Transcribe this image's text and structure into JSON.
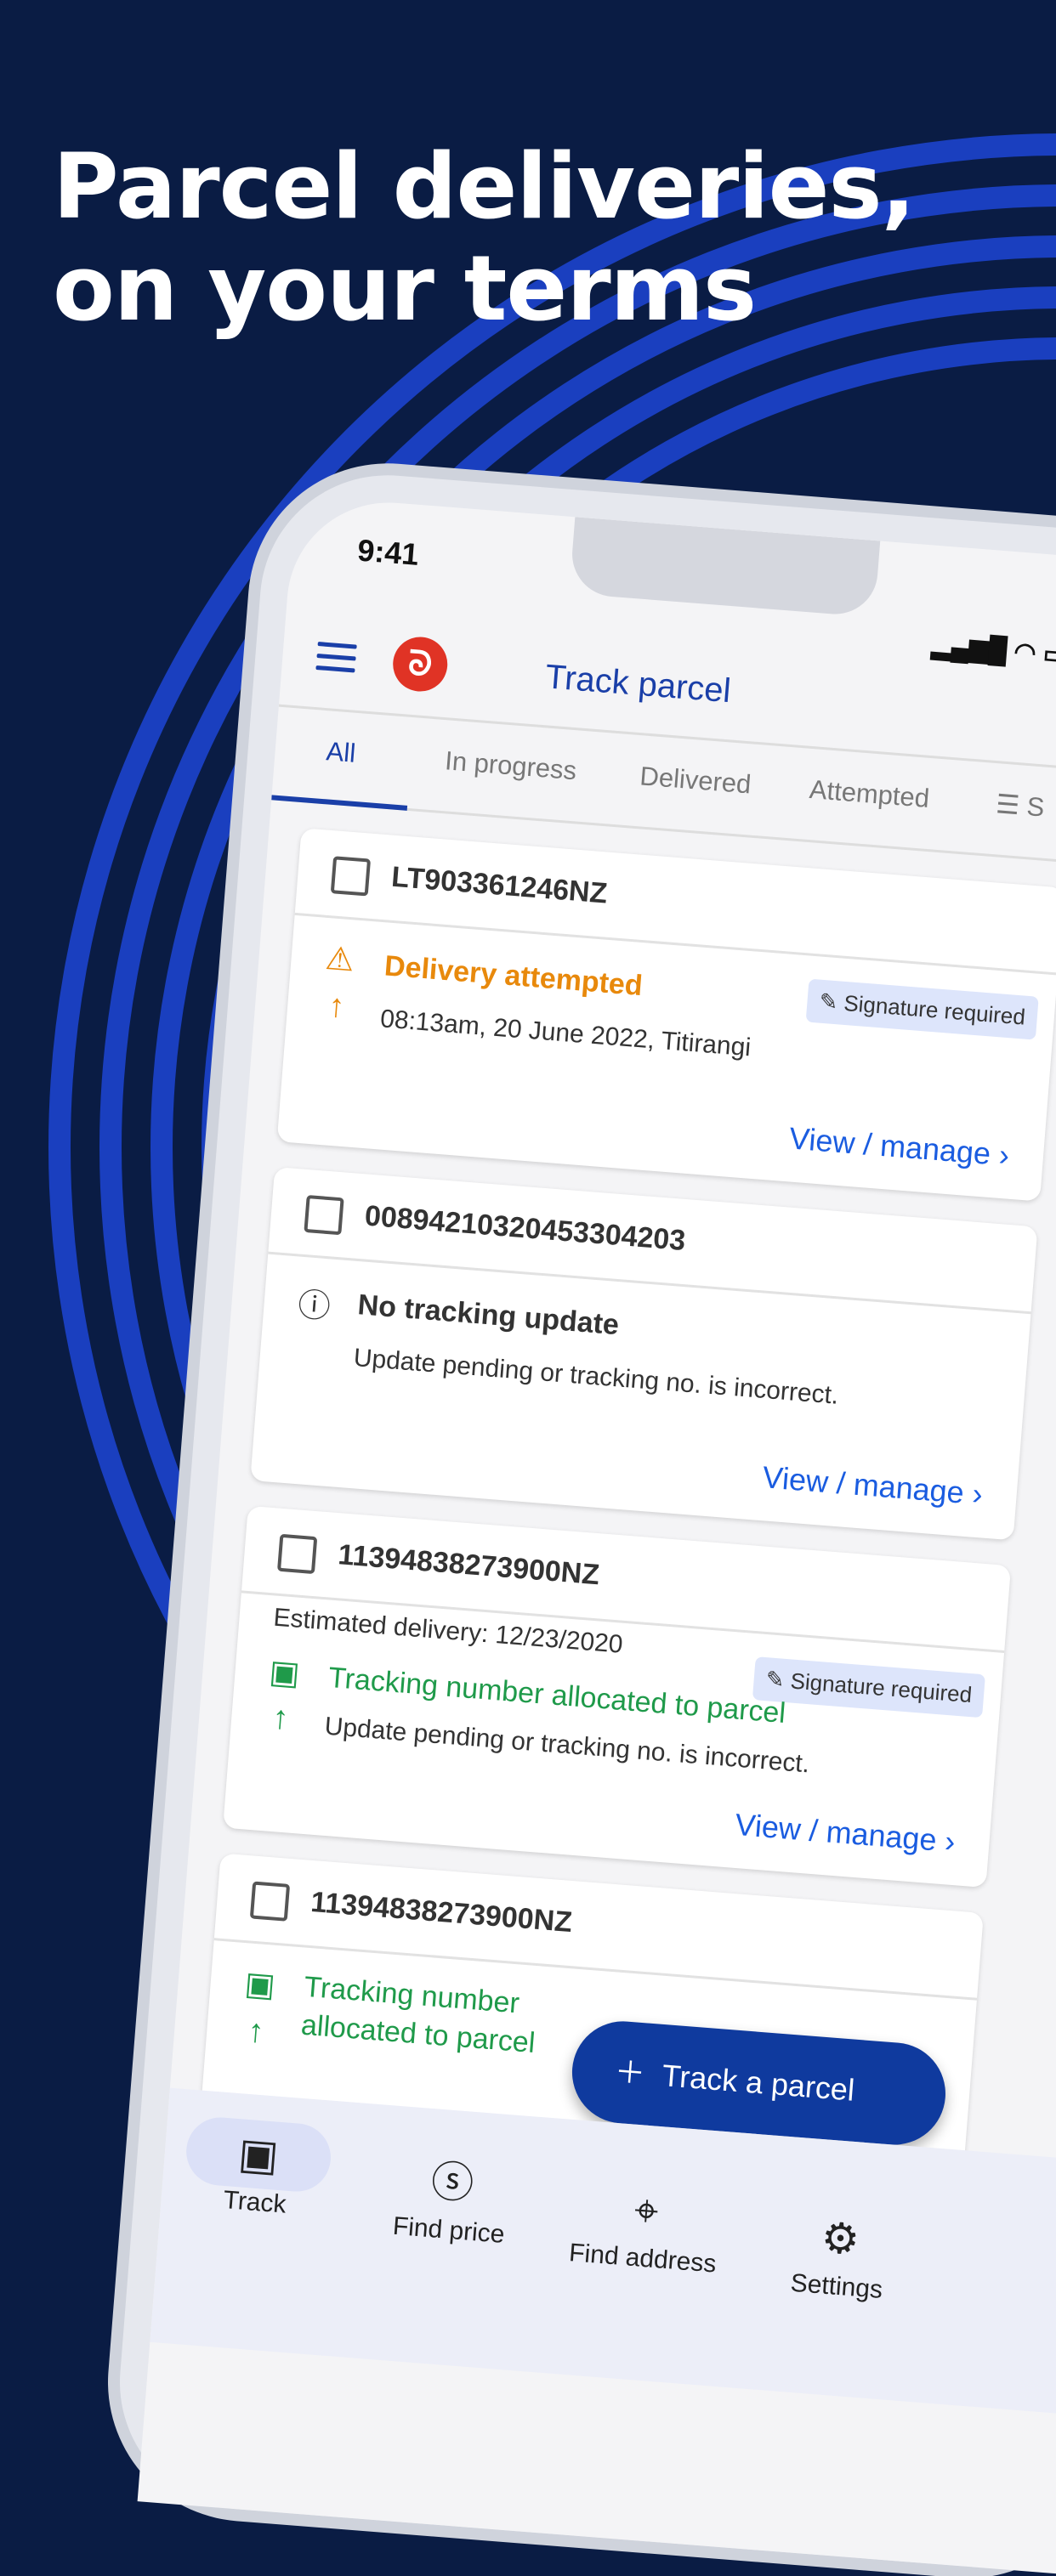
{
  "headline": [
    "Parcel deliveries,",
    "on your terms"
  ],
  "status_bar": {
    "time": "9:41",
    "icons": "signal wifi battery"
  },
  "header": {
    "title": "Track parcel",
    "menu_icon": "hamburger-icon",
    "logo": "NZ Post"
  },
  "tabs": [
    {
      "label": "All",
      "active": true
    },
    {
      "label": "In progress"
    },
    {
      "label": "Delivered"
    },
    {
      "label": "Attempted"
    },
    {
      "label": "S",
      "icon": "sort-icon"
    }
  ],
  "cards": [
    {
      "tracking": "LT903361246NZ",
      "status": "Delivery attempted",
      "status_color": "#e8890c",
      "icon": "truck-alert-icon",
      "detail": "08:13am, 20 June 2022, Titirangi",
      "badge": "Signature required",
      "link": "View / manage"
    },
    {
      "tracking": "00894210320453304203",
      "status": "No tracking update",
      "status_color": "#333333",
      "icon": "info-icon",
      "detail": "Update pending or tracking no. is incorrect.",
      "link": "View / manage"
    },
    {
      "tracking": "11394838273900NZ",
      "estimated": "Estimated delivery: 12/23/2020",
      "status": "Tracking number allocated to parcel",
      "status_color": "#1f9a4a",
      "icon": "parcel-icon",
      "detail": "Update pending or tracking no. is incorrect.",
      "badge": "Signature required",
      "link": "View / manage"
    },
    {
      "tracking": "11394838273900NZ",
      "status": "Tracking number",
      "status2": "allocated to parcel",
      "status_color": "#1f9a4a",
      "icon": "parcel-icon"
    }
  ],
  "fab": {
    "label": "Track a parcel"
  },
  "nav": [
    {
      "label": "Track",
      "icon": "parcel-icon",
      "active": true
    },
    {
      "label": "Find price",
      "icon": "dollar-icon"
    },
    {
      "label": "Find address",
      "icon": "location-pin-icon"
    },
    {
      "label": "Settings",
      "icon": "gear-icon"
    }
  ],
  "colors": {
    "background": "#0a1c44",
    "arcs": "#1a3fbf",
    "brand_blue": "#1a3fa8",
    "logo_red": "#e03325"
  }
}
